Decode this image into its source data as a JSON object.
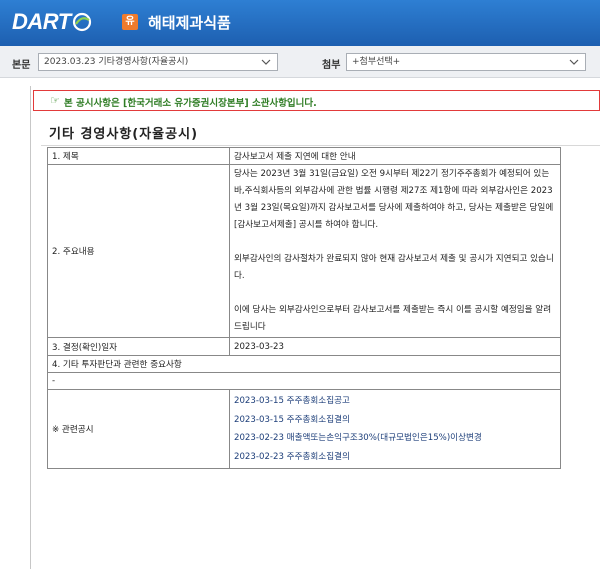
{
  "header": {
    "logo": "DART",
    "company_badge": "유",
    "company_name": "해태제과식품"
  },
  "toolbar": {
    "report_label": "본문",
    "report_select": "2023.03.23  기타경영사항(자율공시)",
    "attach_label": "첨부",
    "attach_select": "+첨부선택+"
  },
  "notice": {
    "text": "본 공시사항은 [한국거래소 유가증권시장본부] 소관사항입니다."
  },
  "document": {
    "title": "기타 경영사항(자율공시)",
    "rows": {
      "subject_label": "1. 제목",
      "subject_value": "감사보고서 제출 지연에 대한 안내",
      "content_label": "2. 주요내용",
      "content_p1": "당사는 2023년 3월 31일(금요일) 오전 9시부터 제22기 정기주주총회가 예정되어 있는 바,주식회사등의 외부감사에 관한 법률 시행령 제27조 제1항에 따라 외부감사인은 2023년 3월 23일(목요일)까지 감사보고서를 당사에 제출하여야 하고, 당사는 제출받은 당일에 [감사보고서제출] 공시를 하여야 합니다.",
      "content_p2": "외부감사인의 감사절차가 완료되지 않아 현재 감사보고서 제출 및 공시가 지연되고 있습니다.",
      "content_p3": "이에 당사는 외부감사인으로부터 감사보고서를 제출받는 즉시 이를 공시할 예정임을 알려드립니다",
      "date_label": "3. 결정(확인)일자",
      "date_value": "2023-03-23",
      "other_label": "4. 기타 투자판단과 관련한 중요사항",
      "other_value": "-",
      "related_label": "※ 관련공시",
      "related": [
        "2023-03-15 주주총회소집공고",
        "2023-03-15 주주총회소집결의",
        "2023-02-23 매출액또는손익구조30%(대규모법인은15%)이상변경",
        "2023-02-23 주주총회소집결의"
      ]
    }
  },
  "colors": {
    "header_blue": "#2670c4",
    "badge_orange": "#f07b2c",
    "notice_border": "#e23a3a",
    "notice_text": "#2f7d25",
    "link_text": "#1e3f7a"
  }
}
